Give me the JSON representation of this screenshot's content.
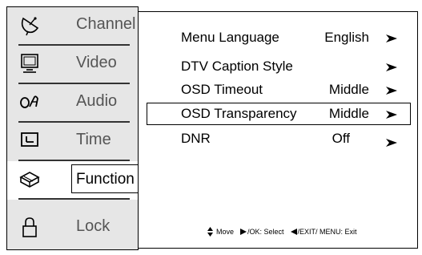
{
  "sidebar": {
    "items": [
      {
        "label": "Channel",
        "icon": "satellite-dish-icon"
      },
      {
        "label": "Video",
        "icon": "monitor-icon"
      },
      {
        "label": "Audio",
        "icon": "audio-icon"
      },
      {
        "label": "Time",
        "icon": "clock-icon"
      },
      {
        "label": "Function",
        "icon": "toolbox-icon",
        "active": true
      },
      {
        "label": "Lock",
        "icon": "lock-icon"
      }
    ]
  },
  "menu": {
    "rows": [
      {
        "name": "Menu Language",
        "value": "English"
      },
      {
        "name": "DTV Caption Style",
        "value": ""
      },
      {
        "name": "OSD Timeout",
        "value": "Middle"
      },
      {
        "name": "OSD Transparency",
        "value": "Middle",
        "selected": true
      },
      {
        "name": "DNR",
        "value": "Off"
      }
    ]
  },
  "hint": {
    "move": "Move",
    "select": "/OK: Select",
    "exit": "/EXIT/ MENU: Exit"
  }
}
